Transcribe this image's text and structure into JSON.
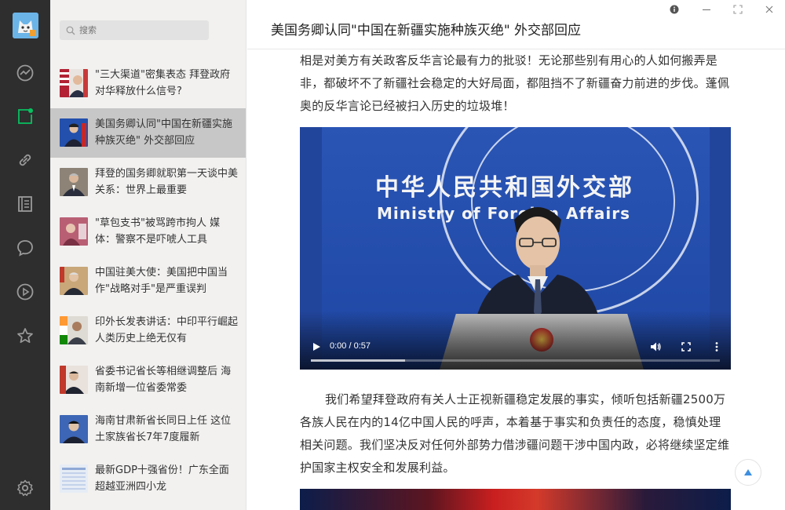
{
  "app": {
    "icon": "app-avatar-icon"
  },
  "rail": {
    "icons": [
      "trend-icon",
      "subscription-icon",
      "link-icon",
      "book-icon",
      "chat-icon",
      "play-icon",
      "star-icon"
    ],
    "active": "subscription-icon",
    "settings_icon": "gear-icon",
    "active_color": "#07c160",
    "icon_color": "#9a9a9a"
  },
  "search": {
    "placeholder": "搜索",
    "icon": "search-icon"
  },
  "list": {
    "active_index": 1,
    "items": [
      {
        "title": "\"三大渠道\"密集表态 拜登政府对华释放什么信号?"
      },
      {
        "title": "美国务卿认同\"中国在新疆实施种族灭绝\" 外交部回应"
      },
      {
        "title": "拜登的国务卿就职第一天谈中美关系：世界上最重要"
      },
      {
        "title": "\"草包支书\"被骂跨市拘人 媒体：警察不是吓唬人工具"
      },
      {
        "title": "中国驻美大使：美国把中国当作\"战略对手\"是严重误判"
      },
      {
        "title": "印外长发表讲话：中印平行崛起 人类历史上绝无仅有"
      },
      {
        "title": "省委书记省长等相继调整后 海南新增一位省委常委"
      },
      {
        "title": "海南甘肃新省长同日上任 这位土家族省长7年7度履新"
      },
      {
        "title": "最新GDP十强省份！广东全面超越亚洲四小龙"
      }
    ]
  },
  "article": {
    "title": "美国务卿认同\"中国在新疆实施种族灭绝\" 外交部回应",
    "para1": "相是对美方有关政客反华言论最有力的批驳！无论那些别有用心的人如何搬弄是非，都破坏不了新疆社会稳定的大好局面，都阻挡不了新疆奋力前进的步伐。蓬佩奥的反华言论已经被扫入历史的垃圾堆！",
    "para2": "我们希望拜登政府有关人士正视新疆稳定发展的事实，倾听包括新疆2500万各族人民在内的14亿中国人民的呼声，本着基于事实和负责任的态度，稳慎处理相关问题。我们坚决反对任何外部势力借涉疆问题干涉中国内政，必将继续坚定维护国家主权安全和发展利益。",
    "video": {
      "backdrop_cn": "中华人民共和国外交部",
      "backdrop_en": "Ministry of Foreign Affairs",
      "time": "0:00 / 0:57",
      "buffered_fraction": 0.23,
      "played_fraction": 0.0
    }
  },
  "window": {
    "controls": [
      "info-icon",
      "minimize-icon",
      "maximize-icon",
      "close-icon"
    ]
  },
  "scroll_top_icon": "arrow-up-icon"
}
